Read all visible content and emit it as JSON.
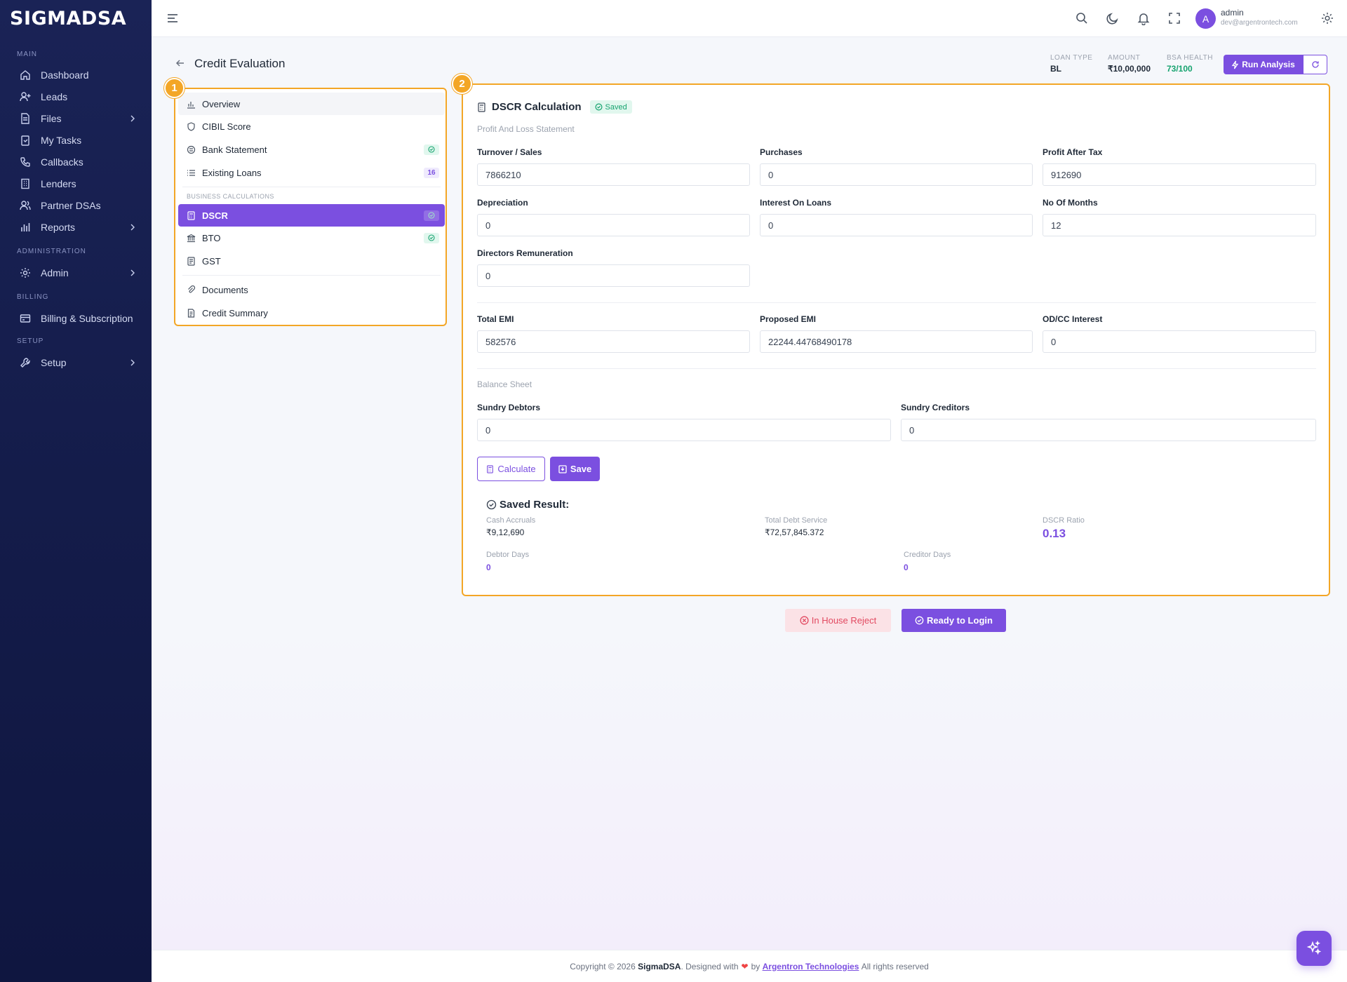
{
  "app": {
    "logo": "SIGMADSA"
  },
  "sidebar": {
    "sections": [
      "MAIN",
      "ADMINISTRATION",
      "BILLING",
      "SETUP"
    ],
    "items": [
      {
        "label": "Dashboard",
        "icon": "home-icon"
      },
      {
        "label": "Leads",
        "icon": "user-plus-icon"
      },
      {
        "label": "Files",
        "icon": "file-icon",
        "expandable": true
      },
      {
        "label": "My Tasks",
        "icon": "clipboard-icon"
      },
      {
        "label": "Callbacks",
        "icon": "phone-icon"
      },
      {
        "label": "Lenders",
        "icon": "building-icon"
      },
      {
        "label": "Partner DSAs",
        "icon": "users-icon"
      },
      {
        "label": "Reports",
        "icon": "bar-chart-icon",
        "expandable": true
      },
      {
        "label": "Admin",
        "icon": "gear-icon",
        "expandable": true
      },
      {
        "label": "Billing & Subscription",
        "icon": "credit-card-icon"
      },
      {
        "label": "Setup",
        "icon": "wrench-icon",
        "expandable": true
      }
    ]
  },
  "user": {
    "initial": "A",
    "name": "admin",
    "email": "dev@argentrontech.com"
  },
  "header": {
    "title": "Credit Evaluation",
    "meta": [
      {
        "key": "LOAN TYPE",
        "value": "BL"
      },
      {
        "key": "AMOUNT",
        "value": "₹10,00,000"
      },
      {
        "key": "BSA HEALTH",
        "value": "73/100"
      }
    ],
    "run_label": "Run Analysis",
    "accent": "#7b4fe0",
    "highlight": "#f3a626",
    "health_color": "#16a36f"
  },
  "nav": {
    "step": "1",
    "section_label": "BUSINESS CALCULATIONS",
    "items": [
      {
        "label": "Overview"
      },
      {
        "label": "CIBIL Score"
      },
      {
        "label": "Bank Statement"
      },
      {
        "label": "Existing Loans",
        "count": "16"
      },
      {
        "label": "DSCR"
      },
      {
        "label": "BTO"
      },
      {
        "label": "GST"
      },
      {
        "label": "Documents"
      },
      {
        "label": "Credit Summary"
      }
    ]
  },
  "dscr": {
    "step": "2",
    "title": "DSCR Calculation",
    "status": "Saved",
    "pl_label": "Profit And Loss Statement",
    "bs_label": "Balance Sheet",
    "fields": {
      "turnover": {
        "label": "Turnover / Sales",
        "value": "7866210"
      },
      "purchases": {
        "label": "Purchases",
        "value": "0"
      },
      "pat": {
        "label": "Profit After Tax",
        "value": "912690"
      },
      "depreciation": {
        "label": "Depreciation",
        "value": "0"
      },
      "interest": {
        "label": "Interest On Loans",
        "value": "0"
      },
      "months": {
        "label": "No Of Months",
        "value": "12"
      },
      "directors": {
        "label": "Directors Remuneration",
        "value": "0"
      },
      "total_emi": {
        "label": "Total EMI",
        "value": "582576"
      },
      "proposed_emi": {
        "label": "Proposed EMI",
        "value": "22244.44768490178"
      },
      "odcc": {
        "label": "OD/CC Interest",
        "value": "0"
      },
      "debtors": {
        "label": "Sundry Debtors",
        "value": "0"
      },
      "creditors": {
        "label": "Sundry Creditors",
        "value": "0"
      }
    },
    "calculate_label": "Calculate",
    "save_label": "Save",
    "result": {
      "title": "Saved Result:",
      "cash_accruals": {
        "label": "Cash Accruals",
        "value": "₹9,12,690"
      },
      "total_debt": {
        "label": "Total Debt Service",
        "value": "₹72,57,845.372"
      },
      "ratio": {
        "label": "DSCR Ratio",
        "value": "0.13"
      },
      "debtor_days": {
        "label": "Debtor Days",
        "value": "0"
      },
      "creditor_days": {
        "label": "Creditor Days",
        "value": "0"
      }
    }
  },
  "actions": {
    "reject_label": "In House Reject",
    "ready_label": "Ready to Login"
  },
  "footer": {
    "prefix": "Copyright © 2026",
    "brand": "SigmaDSA",
    "mid": ". Designed with",
    "by": "by",
    "company": "Argentron Technologies",
    "suffix": "All rights reserved"
  }
}
